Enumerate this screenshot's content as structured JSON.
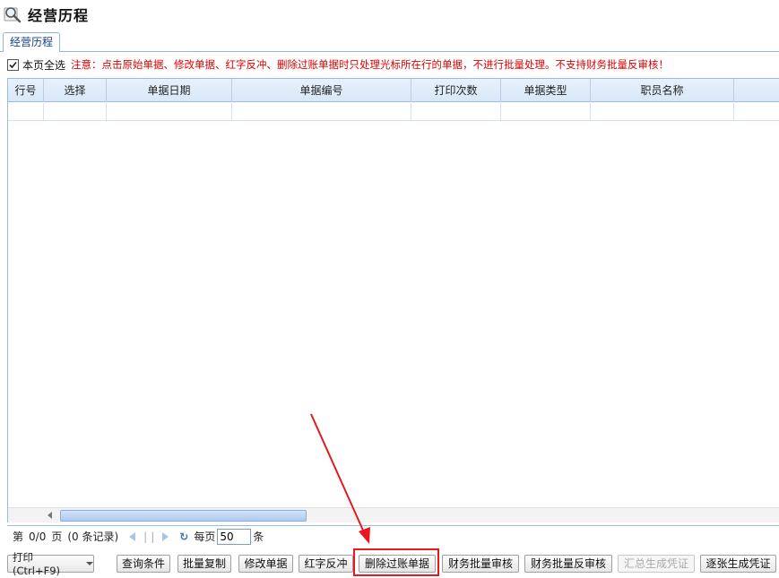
{
  "page": {
    "title": "经营历程",
    "title_icon": "magnifier-icon"
  },
  "tabs": [
    {
      "label": "经营历程",
      "active": true
    }
  ],
  "select_all": {
    "label": "本页全选",
    "checked": true
  },
  "notice": "注意：点击原始单据、修改单据、红字反冲、删除过账单据时只处理光标所在行的单据，不进行批量处理。不支持财务批量反审核！",
  "grid": {
    "columns": [
      "行号",
      "选择",
      "单据日期",
      "单据编号",
      "打印次数",
      "单据类型",
      "职员名称",
      ""
    ],
    "rows": []
  },
  "pager": {
    "page_prefix": "第",
    "page_value": "0/0",
    "page_suffix": "页",
    "records": "(0 条记录)",
    "refresh_glyph": "↻",
    "per_page_label": "每页",
    "per_page_value": "50",
    "per_page_unit": "条"
  },
  "toolbar": {
    "print_label": "打印(Ctrl+F9)",
    "buttons": [
      {
        "label": "查询条件",
        "enabled": true
      },
      {
        "label": "批量复制",
        "enabled": true
      },
      {
        "label": "修改单据",
        "enabled": true
      },
      {
        "label": "红字反冲",
        "enabled": true
      },
      {
        "label": "删除过账单据",
        "enabled": true,
        "highlighted": true
      },
      {
        "label": "财务批量审核",
        "enabled": true
      },
      {
        "label": "财务批量反审核",
        "enabled": true
      },
      {
        "label": "汇总生成凭证",
        "enabled": false
      },
      {
        "label": "逐张生成凭证",
        "enabled": true
      }
    ]
  },
  "annotation": {
    "color": "#e8191e"
  },
  "colors": {
    "accent": "#15428b",
    "border": "#99bbe8",
    "warning": "#e00000"
  }
}
